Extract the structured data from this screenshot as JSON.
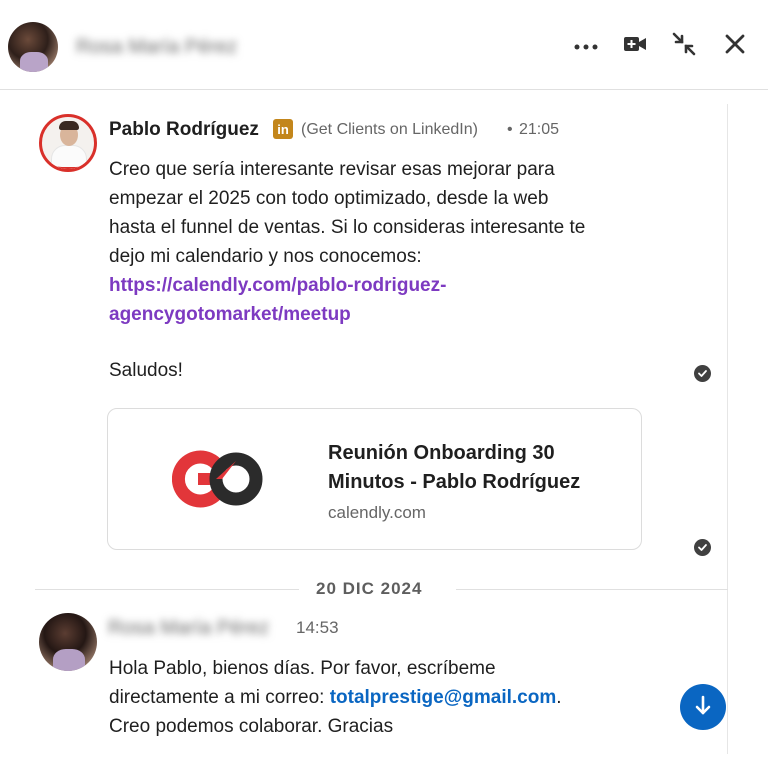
{
  "header": {
    "contact_name": "Rosa María Pérez",
    "icons": [
      "more-icon",
      "video-call-icon",
      "collapse-icon",
      "close-icon"
    ]
  },
  "messages": [
    {
      "sender": "Pablo Rodríguez",
      "badge": "in",
      "headline": "(Get Clients on LinkedIn)",
      "separator": "•",
      "time": "21:05",
      "lines": [
        "Creo que sería interesante revisar esas mejorar para",
        "empezar el 2025 con todo optimizado, desde la web",
        "hasta el funnel de ventas. Si lo consideras interesante te",
        "dejo mi calendario y nos conocemos:"
      ],
      "link_lines": [
        "https://calendly.com/pablo-rodriguez-",
        "agencygotomarket/meetup"
      ],
      "closing": "Saludos!"
    }
  ],
  "link_card": {
    "title": "Reunión Onboarding 30 Minutos - Pablo Rodríguez",
    "domain": "calendly.com",
    "logo_colors": {
      "red": "#e2363a",
      "dark": "#2b2b2b"
    }
  },
  "date_separator": "20 DIC 2024",
  "reply": {
    "sender": "Rosa María Pérez",
    "time": "14:53",
    "line1": "Hola Pablo, bienos días. Por favor, escríbeme",
    "line2_prefix": "directamente a mi correo: ",
    "email": "totalprestige@gmail.com",
    "line2_suffix": ".",
    "line3": "Creo podemos colaborar. Gracias"
  },
  "colors": {
    "link_purple": "#7d3ac1",
    "link_blue": "#0a66c2",
    "badge_gold": "#c3861b",
    "scroll_button": "#0a66c2"
  }
}
